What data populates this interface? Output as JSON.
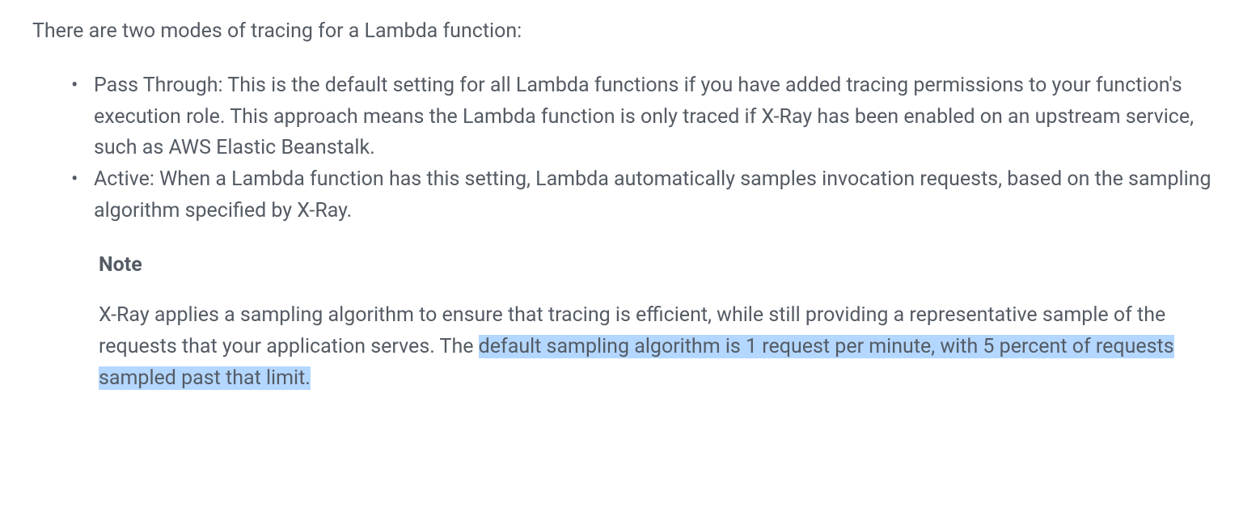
{
  "intro": "There are two modes of tracing for a Lambda function:",
  "bullets": [
    "Pass Through: This is the default setting for all Lambda functions if you have added tracing permissions to your function's execution role. This approach means the Lambda function is only traced if X-Ray has been enabled on an upstream service, such as AWS Elastic Beanstalk.",
    "Active: When a Lambda function has this setting, Lambda automatically samples invocation requests, based on the sampling algorithm specified by X-Ray."
  ],
  "note": {
    "heading": "Note",
    "bodyPrefix": "X-Ray applies a sampling algorithm to ensure that tracing is efficient, while still providing a representative sample of the requests that your application serves. The ",
    "bodyHighlighted": "default sampling algorithm is 1 request per minute, with 5 percent of requests sampled past that limit."
  }
}
